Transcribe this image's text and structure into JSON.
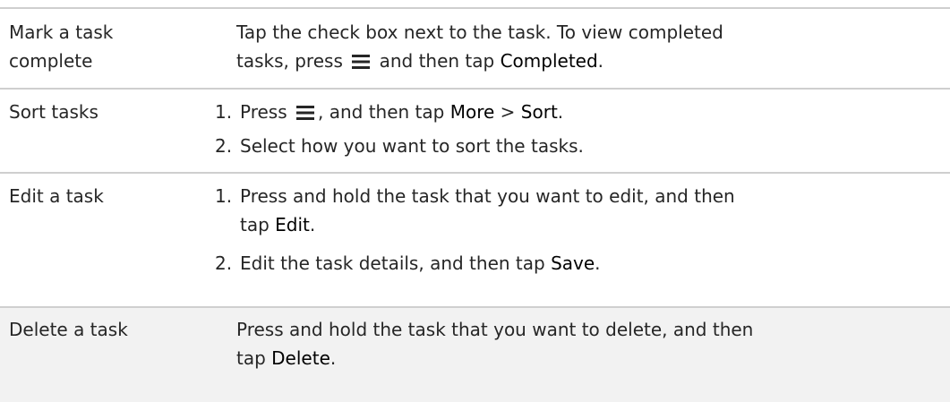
{
  "rows": [
    {
      "label_line1": "Mark a task",
      "label_line2": "complete",
      "desc_line1": "Tap the check box next to the task. To view completed",
      "desc_line2_a": "tasks, press",
      "desc_line2_b": "and then tap",
      "desc_line2_bold": "Completed",
      "desc_line2_end": "."
    },
    {
      "label": "Sort tasks",
      "step1_num": "1.",
      "step1_a": "Press",
      "step1_b": ", and then tap",
      "step1_more": "More",
      "step1_gt": ">",
      "step1_sort": "Sort",
      "step1_end": ".",
      "step2_num": "2.",
      "step2_text": "Select how you want to sort the tasks."
    },
    {
      "label": "Edit a task",
      "step1_num": "1.",
      "step1_line1": "Press and hold the task that you want to edit, and then",
      "step1_line2_a": "tap",
      "step1_line2_bold": "Edit",
      "step1_line2_end": ".",
      "step2_num": "2.",
      "step2_a": "Edit the task details, and then tap",
      "step2_bold": "Save",
      "step2_end": "."
    },
    {
      "label": "Delete a task",
      "desc_line1": "Press and hold the task that you want to delete, and then",
      "desc_line2_a": "tap",
      "desc_line2_bold": "Delete",
      "desc_line2_end": "."
    }
  ],
  "icons": {
    "menu": "menu-icon"
  },
  "colors": {
    "text": "#262626",
    "rule": "#cfcfcf",
    "shade": "#f2f2f2"
  }
}
